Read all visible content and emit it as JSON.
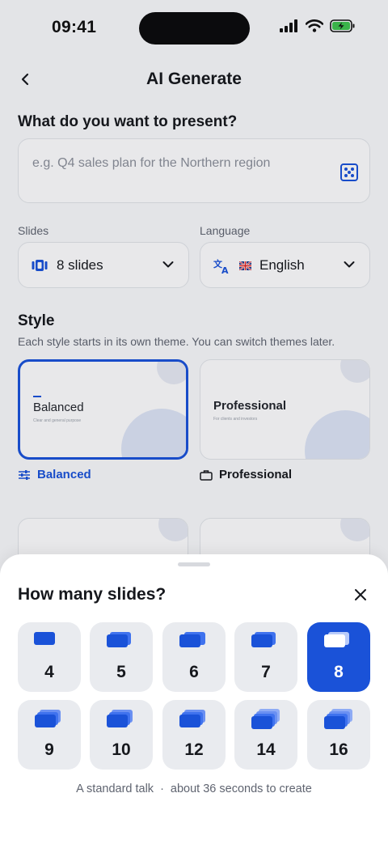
{
  "status_bar": {
    "time": "09:41"
  },
  "nav": {
    "title": "AI Generate"
  },
  "form": {
    "question": "What do you want to present?",
    "prompt_placeholder": "e.g. Q4 sales plan for the Northern region",
    "slides_label": "Slides",
    "slides_value": "8 slides",
    "language_label": "Language",
    "language_value": "English",
    "style_heading": "Style",
    "style_sub": "Each style starts in its own theme. You can switch themes later.",
    "styles": [
      {
        "card_title": "Balanced",
        "card_sub": "Clear and general purpose",
        "caption": "Balanced",
        "selected": true
      },
      {
        "card_title": "Professional",
        "card_sub": "For clients and investors",
        "caption": "Professional",
        "selected": false
      }
    ]
  },
  "sheet": {
    "title": "How many slides?",
    "options": [
      "4",
      "5",
      "6",
      "7",
      "8",
      "9",
      "10",
      "12",
      "14",
      "16"
    ],
    "selected": "8",
    "footer_left": "A standard talk",
    "footer_sep": "·",
    "footer_right": "about 36 seconds to create"
  },
  "colors": {
    "accent": "#1a52d8",
    "option_bg": "#e9ebef"
  }
}
